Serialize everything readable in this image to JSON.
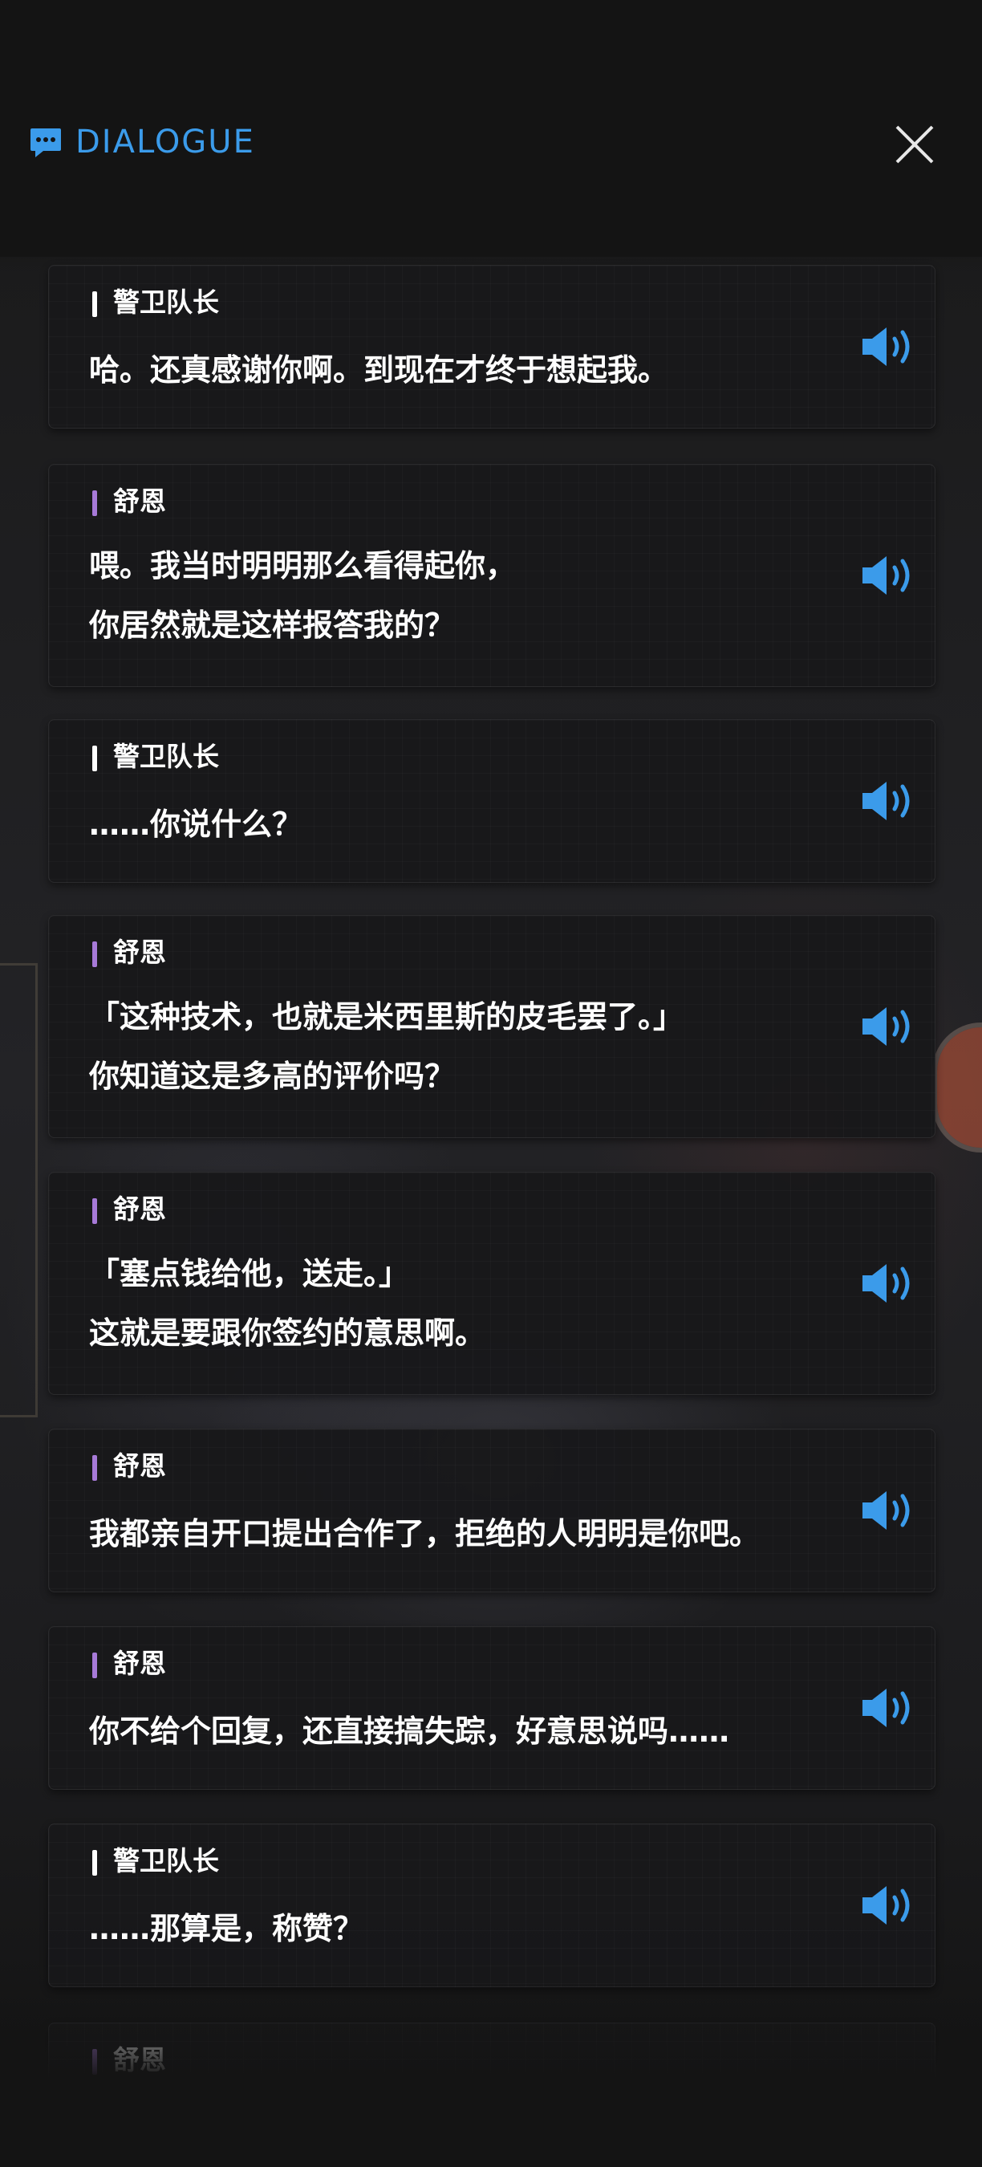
{
  "header": {
    "title": "DIALOGUE",
    "icons": {
      "chat": "chat-bubble-icon",
      "close": "close-icon"
    },
    "accent_color": "#3b9bea"
  },
  "colors": {
    "bar_captain": "#ffffff",
    "bar_shuen": "#a77ad8",
    "voice": "#3b9bea"
  },
  "dialogue": [
    {
      "speaker": "警卫队长",
      "lines": [
        "哈。还真感谢你啊。到现在才终于想起我。"
      ]
    },
    {
      "speaker": "舒恩",
      "lines": [
        "喂。我当时明明那么看得起你，",
        "你居然就是这样报答我的？"
      ]
    },
    {
      "speaker": "警卫队长",
      "lines": [
        "……你说什么？"
      ]
    },
    {
      "speaker": "舒恩",
      "lines": [
        "「这种技术，也就是米西里斯的皮毛罢了。」",
        "你知道这是多高的评价吗？"
      ]
    },
    {
      "speaker": "舒恩",
      "lines": [
        "「塞点钱给他，送走。」",
        "这就是要跟你签约的意思啊。"
      ]
    },
    {
      "speaker": "舒恩",
      "lines": [
        "我都亲自开口提出合作了，拒绝的人明明是你吧。"
      ]
    },
    {
      "speaker": "舒恩",
      "lines": [
        "你不给个回复，还直接搞失踪，好意思说吗……"
      ]
    },
    {
      "speaker": "警卫队长",
      "lines": [
        "……那算是，称赞？"
      ]
    },
    {
      "speaker": "舒恩",
      "lines": []
    }
  ]
}
